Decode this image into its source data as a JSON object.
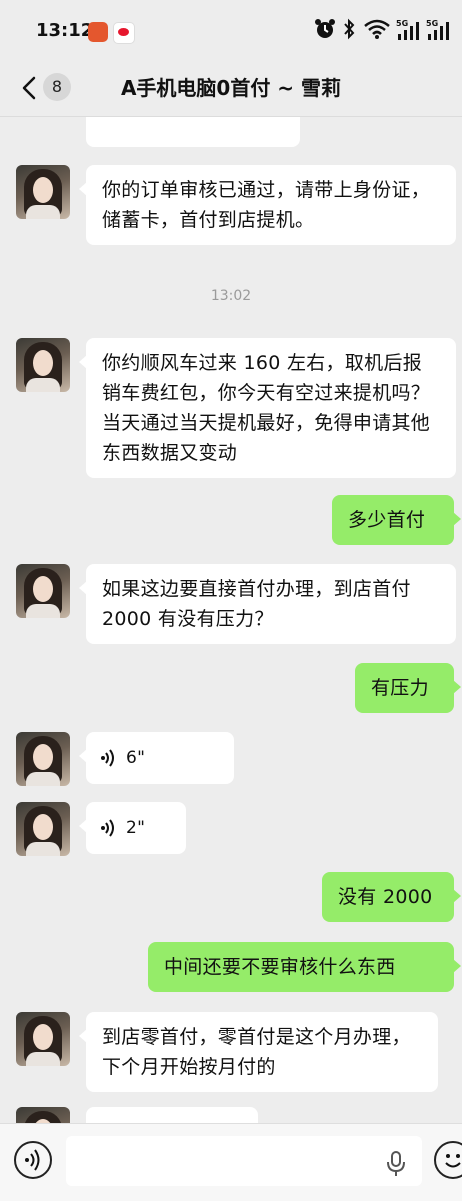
{
  "status_bar": {
    "time": "13:12",
    "icons": [
      "app-icon-red",
      "weibo-icon",
      "alarm-icon",
      "bluetooth-icon",
      "wifi-icon",
      "signal-5g-icon",
      "signal-5g-icon"
    ],
    "network_labels": [
      "5G",
      "5G"
    ]
  },
  "header": {
    "back_icon": "chevron-left-icon",
    "unread_count": "8",
    "title": "A手机电脑0首付 ~ 雪莉"
  },
  "messages": [
    {
      "type": "text",
      "from": "contact",
      "text": "你的订单审核已通过，请带上身份证，储蓄卡，首付到店提机。"
    },
    {
      "type": "time",
      "text": "13:02"
    },
    {
      "type": "text",
      "from": "contact",
      "text": "你约顺风车过来 160 左右，取机后报销车费红包，你今天有空过来提机吗？当天通过当天提机最好，免得申请其他东西数据又变动"
    },
    {
      "type": "text",
      "from": "me",
      "text": "多少首付"
    },
    {
      "type": "text",
      "from": "contact",
      "text": "如果这边要直接首付办理，到店首付 2000 有没有压力？"
    },
    {
      "type": "text",
      "from": "me",
      "text": "有压力"
    },
    {
      "type": "voice",
      "from": "contact",
      "duration": "6\""
    },
    {
      "type": "voice",
      "from": "contact",
      "duration": "2\""
    },
    {
      "type": "text",
      "from": "me",
      "text": "没有 2000"
    },
    {
      "type": "text",
      "from": "me",
      "text": "中间还要不要审核什么东西"
    },
    {
      "type": "text",
      "from": "contact",
      "text": "到店零首付，零首付是这个月办理，下个月开始按月付的"
    }
  ],
  "input_bar": {
    "left_icon": "voice-mode-icon",
    "mic_icon": "microphone-icon",
    "right_icon": "emoji-icon",
    "placeholder": ""
  },
  "colors": {
    "background": "#ededed",
    "incoming_bubble": "#ffffff",
    "outgoing_bubble": "#95ec69",
    "timestamp": "#9a9a9a"
  }
}
